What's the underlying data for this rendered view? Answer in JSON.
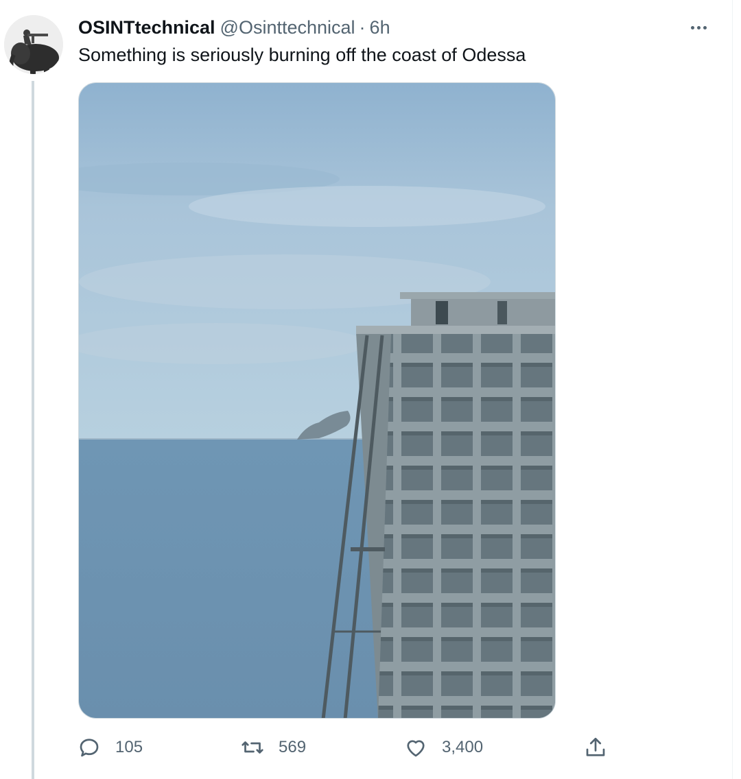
{
  "tweet": {
    "author": {
      "display_name": "OSINTtechnical",
      "handle": "@Osinttechnical",
      "separator": "·",
      "time": "6h"
    },
    "text": "Something is seriously burning off the coast of Odessa",
    "media": {
      "icon": "photo-smoke-offshore-building"
    },
    "stats": {
      "replies": "105",
      "retweets": "569",
      "likes": "3,400"
    }
  },
  "icons": {
    "more": "more-horizontal-icon",
    "reply": "reply-icon",
    "retweet": "retweet-icon",
    "like": "heart-icon",
    "share": "share-icon"
  },
  "colors": {
    "text_primary": "#0f1419",
    "text_secondary": "#536471",
    "thread_line": "#cfd9de"
  }
}
